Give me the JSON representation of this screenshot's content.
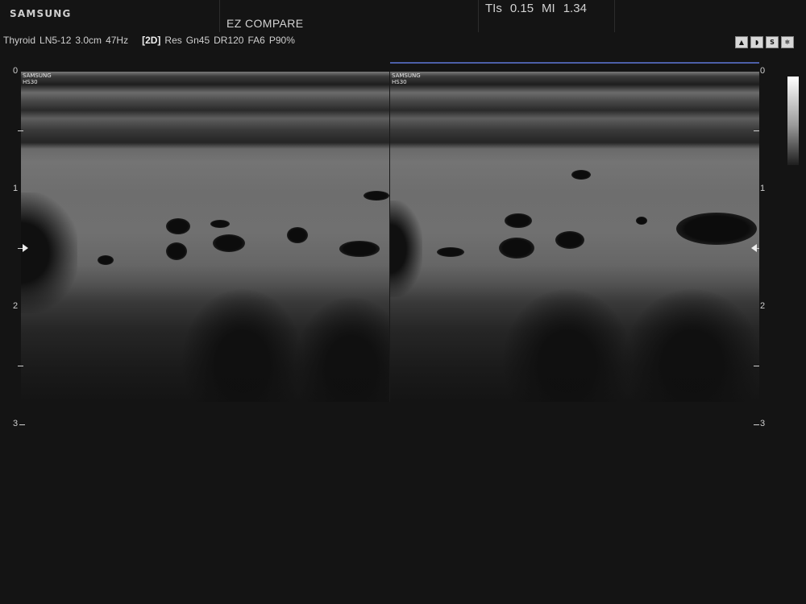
{
  "header": {
    "brand": "SAMSUNG",
    "mode_title": "EZ COMPARE",
    "safety": {
      "ti_label": "TIs",
      "ti_value": "0.15",
      "mi_label": "MI",
      "mi_value": "1.34"
    },
    "params": {
      "preset": "Thyroid",
      "probe": "LN5-12",
      "depth": "3.0cm",
      "frame_rate": "47Hz",
      "mode": "[2D]",
      "res": "Res",
      "gain": "Gn45",
      "dynamic_range": "DR120",
      "frame_avg": "FA6",
      "power": "P90%"
    },
    "status_icons": [
      "probe-icon",
      "scan-icon",
      "harmonic-icon",
      "freeze-icon"
    ],
    "status_icon_glyphs": [
      "▲",
      "◗",
      "S",
      "❄"
    ]
  },
  "panes": {
    "left": {
      "label_line1": "SAMSUNG",
      "label_line2": "HS30"
    },
    "right": {
      "label_line1": "SAMSUNG",
      "label_line2": "HS30",
      "active": true
    }
  },
  "scale": {
    "unit": "cm",
    "labels": [
      "0",
      "1",
      "2",
      "3"
    ],
    "minor_tick": "-"
  },
  "colors": {
    "background": "#141414",
    "active_pane_line": "#4c5fa8",
    "text": "#d6d6d6"
  }
}
